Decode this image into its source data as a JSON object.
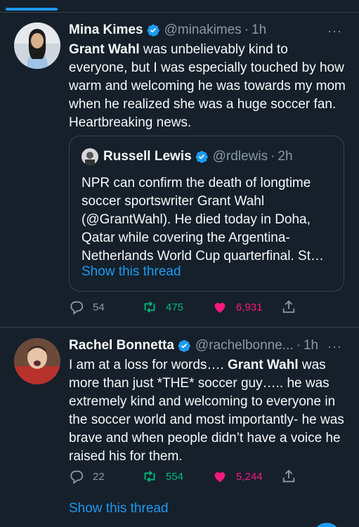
{
  "colors": {
    "background": "#15202b",
    "accent": "#1d9bf0",
    "retweet": "#00ba7c",
    "like": "#f91880",
    "muted": "#8b98a5",
    "border": "#38444d"
  },
  "tweets": [
    {
      "name": "Mina Kimes",
      "handle": "@minakimes",
      "time": "1h",
      "dot": "·",
      "more": "···",
      "text_bold": "Grant Wahl",
      "text_rest": " was unbelievably kind to everyone, but I was especially touched by how warm and welcoming  he was towards my mom when he realized she was a huge soccer fan. Heartbreaking news.",
      "quote": {
        "name": "Russell Lewis",
        "handle": "@rdlewis",
        "time": "2h",
        "dot": "·",
        "text": "NPR can confirm the death of longtime soccer sportswriter Grant Wahl (@GrantWahl). He died today in Doha, Qatar while covering the Argentina-Netherlands World Cup quarterfinal. St…",
        "show_thread": "Show this thread"
      },
      "replies": "54",
      "retweets": "475",
      "likes": "6,931"
    },
    {
      "name": "Rachel Bonnetta",
      "handle": "@rachelbonne...",
      "time": "1h",
      "dot": "·",
      "more": "···",
      "text_a": "I am at a loss for words…. ",
      "text_bold": "Grant Wahl",
      "text_b": " was more than just *THE* soccer guy….. he was extremely kind and welcoming to everyone in the soccer world and most importantly- he was brave and when people didn’t have a voice he raised his for them.",
      "replies": "22",
      "retweets": "554",
      "likes": "5,244",
      "show_thread": "Show this thread"
    }
  ],
  "icons": [
    "verified-badge-icon",
    "reply-icon",
    "retweet-icon",
    "heart-icon",
    "share-icon"
  ]
}
